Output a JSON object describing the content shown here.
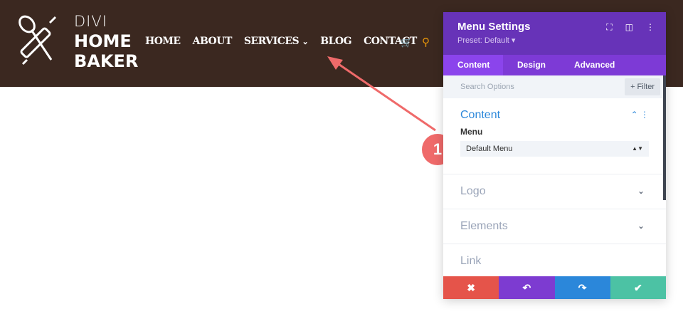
{
  "site": {
    "brand_line1": "DIVI",
    "brand_line2": "HOME",
    "brand_line3": "BAKER",
    "nav": [
      "HOME",
      "ABOUT",
      "SERVICES",
      "BLOG",
      "CONTACT"
    ],
    "services_caret": "⌄"
  },
  "callout": {
    "number": "1",
    "color": "#ef6a6a"
  },
  "panel": {
    "title": "Menu Settings",
    "preset": "Preset: Default ▾",
    "tabs": [
      "Content",
      "Design",
      "Advanced"
    ],
    "search_placeholder": "Search Options",
    "filter_label": "+ Filter",
    "sections": {
      "content": "Content",
      "logo": "Logo",
      "elements": "Elements",
      "link": "Link"
    },
    "menu_label": "Menu",
    "menu_value": "Default Menu",
    "footer": {
      "cancel": "✖",
      "undo": "↶",
      "redo": "↷",
      "save": "✔"
    },
    "colors": {
      "header": "#6733b8",
      "tabs": "#7d3ad6",
      "cancel": "#e5544a",
      "undo": "#7d3bd1",
      "redo": "#2b87da",
      "save": "#4cc2a4"
    }
  }
}
